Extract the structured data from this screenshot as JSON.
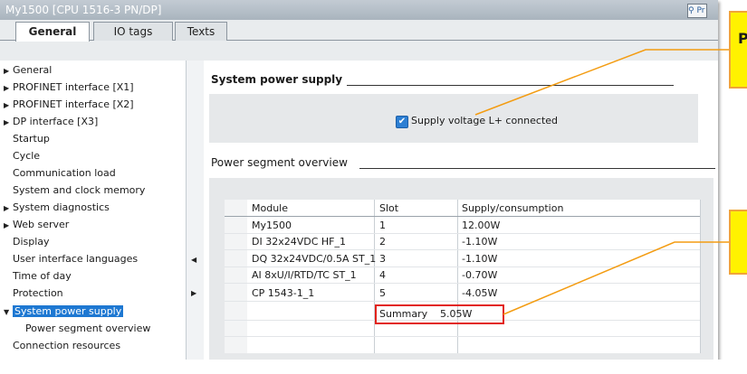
{
  "window": {
    "title": "My1500 [CPU 1516-3 PN/DP]",
    "title_button": "Pr"
  },
  "tabs": [
    {
      "label": "General"
    },
    {
      "label": "IO tags"
    },
    {
      "label": "Texts"
    }
  ],
  "nav": {
    "items": [
      {
        "label": "General"
      },
      {
        "label": "PROFINET interface [X1]"
      },
      {
        "label": "PROFINET interface [X2]"
      },
      {
        "label": "DP interface [X3]"
      },
      {
        "label": "Startup"
      },
      {
        "label": "Cycle"
      },
      {
        "label": "Communication load"
      },
      {
        "label": "System and clock memory"
      },
      {
        "label": "System diagnostics"
      },
      {
        "label": "Web server"
      },
      {
        "label": "Display"
      },
      {
        "label": "User interface languages"
      },
      {
        "label": "Time of day"
      },
      {
        "label": "Protection"
      },
      {
        "label": "System power supply"
      },
      {
        "label": "Power segment overview"
      },
      {
        "label": "Connection resources"
      }
    ],
    "selected": "System power supply"
  },
  "section_power": {
    "title": "System power supply",
    "checkbox_label": "Supply voltage L+ connected",
    "checked": true
  },
  "section_overview": {
    "title": "Power segment overview"
  },
  "table": {
    "columns": [
      "Module",
      "Slot",
      "Supply/consumption"
    ],
    "rows": [
      [
        "My1500",
        "1",
        "12.00W"
      ],
      [
        "DI 32x24VDC HF_1",
        "2",
        "-1.10W"
      ],
      [
        "DQ 32x24VDC/0.5A ST_1",
        "3",
        "-1.10W"
      ],
      [
        "AI 8xU/I/RTD/TC ST_1",
        "4",
        "-0.70W"
      ],
      [
        "CP 1543-1_1",
        "5",
        "-4.05W"
      ]
    ],
    "summary": {
      "label": "Summary",
      "value": "5.05W"
    }
  },
  "callouts": [
    {
      "text": "P"
    },
    {
      "text": ""
    }
  ],
  "icons": {
    "checkbox": "checkmark-icon",
    "expand": "triangle-right-icon",
    "collapse": "triangle-down-icon",
    "title_button_icon": "magnifier-icon"
  },
  "colors": {
    "selection": "#1e78d2",
    "highlight_box": "#e2231a",
    "callout_fill": "#fff200",
    "callout_border": "#f0a33a",
    "leader_line": "#f39c12"
  }
}
